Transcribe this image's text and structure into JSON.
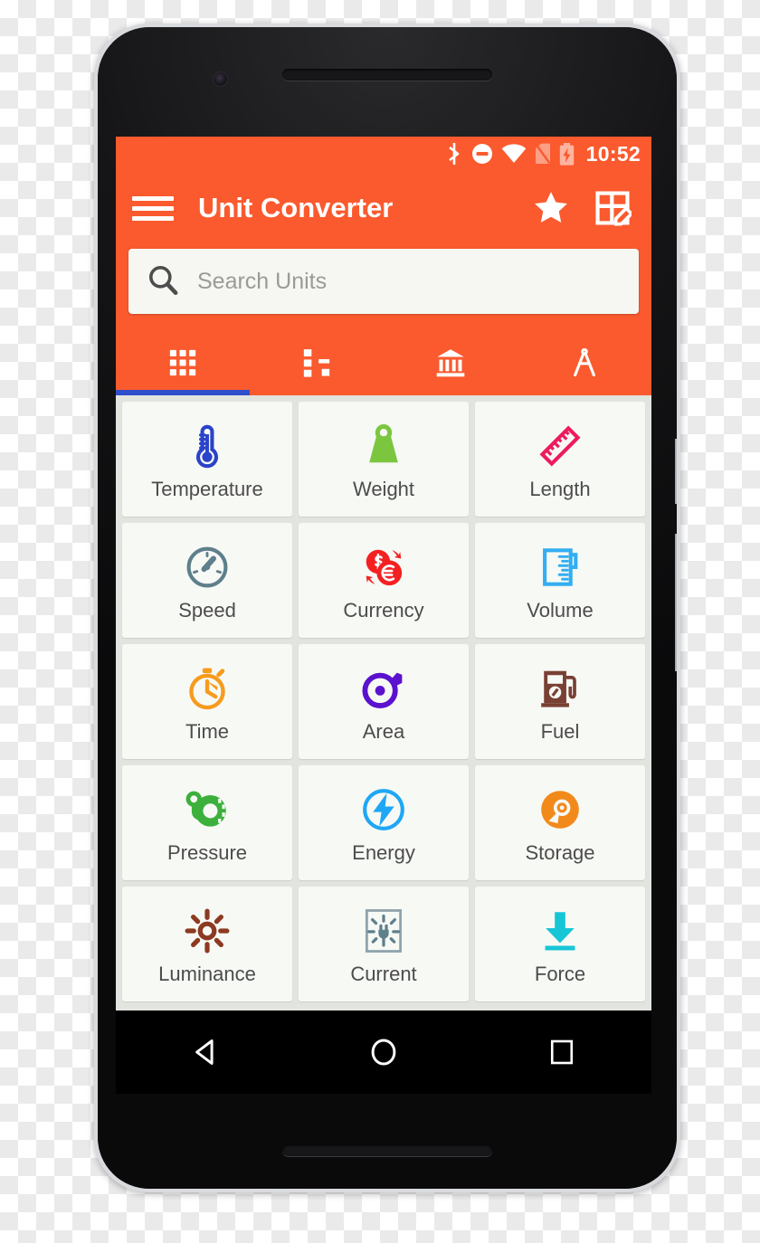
{
  "device": {
    "camera_icon": "front-camera",
    "earpiece_icon": "earpiece-speaker",
    "bottom_speaker_icon": "bottom-speaker",
    "power_button": "power-button",
    "volume_button": "volume-rocker"
  },
  "status_bar": {
    "time": "10:52",
    "icons": [
      "bluetooth-icon",
      "do-not-disturb-icon",
      "wifi-icon",
      "no-sim-icon",
      "battery-charging-icon"
    ],
    "background": "#FA5A2E"
  },
  "app_bar": {
    "title": "Unit Converter",
    "menu_icon": "hamburger-menu-icon",
    "favorite_icon": "star-icon",
    "edit_table_icon": "edit-table-icon",
    "background": "#FA5A2E",
    "text_color": "#FFFFFF"
  },
  "search": {
    "placeholder": "Search Units",
    "icon": "search-icon"
  },
  "tabs": {
    "active_index": 0,
    "indicator_color": "#2F4ECB",
    "items": [
      {
        "name": "grid",
        "icon": "grid-icon"
      },
      {
        "name": "hierarchy",
        "icon": "tree-hierarchy-icon"
      },
      {
        "name": "bank",
        "icon": "bank-icon"
      },
      {
        "name": "compass",
        "icon": "compass-icon"
      }
    ]
  },
  "grid": {
    "background": "#E2E5DF",
    "tile_background": "#F7F9F5",
    "tiles": [
      {
        "label": "Temperature",
        "icon": "thermometer-icon",
        "color": "#2A43C9"
      },
      {
        "label": "Weight",
        "icon": "weight-icon",
        "color": "#7CC63F"
      },
      {
        "label": "Length",
        "icon": "ruler-icon",
        "color": "#EE1A5F"
      },
      {
        "label": "Speed",
        "icon": "speedometer-icon",
        "color": "#5E7F8C"
      },
      {
        "label": "Currency",
        "icon": "currency-coins-icon",
        "color": "#F42121"
      },
      {
        "label": "Volume",
        "icon": "beaker-icon",
        "color": "#33AEF2"
      },
      {
        "label": "Time",
        "icon": "stopwatch-icon",
        "color": "#F79B1E"
      },
      {
        "label": "Area",
        "icon": "tape-measure-icon",
        "color": "#5B12CE"
      },
      {
        "label": "Fuel",
        "icon": "fuel-pump-icon",
        "color": "#7A4034"
      },
      {
        "label": "Pressure",
        "icon": "tire-pressure-icon",
        "color": "#3CB03C"
      },
      {
        "label": "Energy",
        "icon": "lightning-bolt-icon",
        "color": "#1EA7F5"
      },
      {
        "label": "Storage",
        "icon": "disc-storage-icon",
        "color": "#F28A1B"
      },
      {
        "label": "Luminance",
        "icon": "sun-icon",
        "color": "#8C3A21"
      },
      {
        "label": "Current",
        "icon": "current-plug-icon",
        "color": "#5E7F8C"
      },
      {
        "label": "Force",
        "icon": "down-arrow-icon",
        "color": "#17C6D6"
      }
    ]
  },
  "nav_bar": {
    "background": "#000000",
    "buttons": [
      {
        "name": "back",
        "icon": "back-triangle-icon"
      },
      {
        "name": "home",
        "icon": "home-circle-icon"
      },
      {
        "name": "recents",
        "icon": "recents-square-icon"
      }
    ]
  }
}
